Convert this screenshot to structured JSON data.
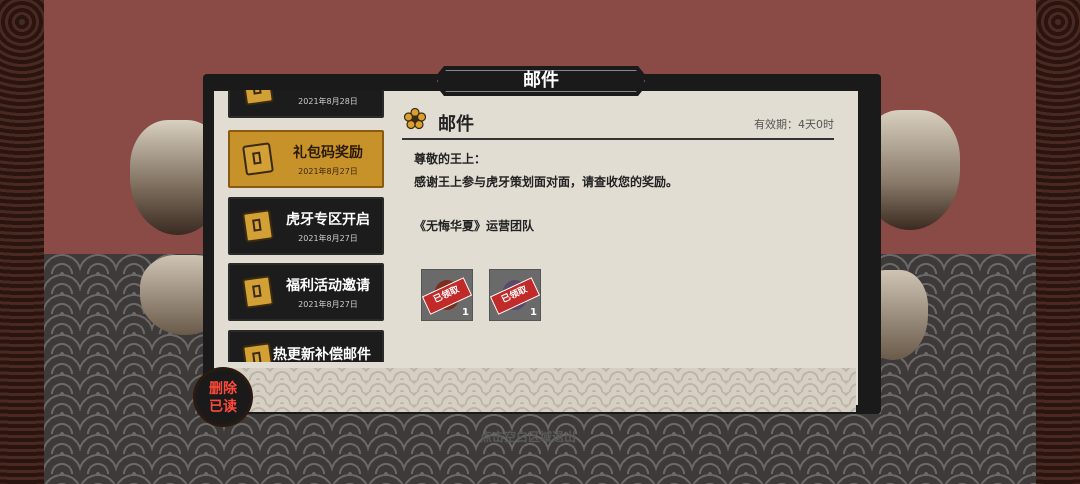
{
  "window": {
    "title": "邮件"
  },
  "mail_list": [
    {
      "title": "",
      "date": "2021年8月28日",
      "active": false
    },
    {
      "title": "礼包码奖励",
      "date": "2021年8月27日",
      "active": true
    },
    {
      "title": "虎牙专区开启",
      "date": "2021年8月27日",
      "active": false
    },
    {
      "title": "福利活动邀请",
      "date": "2021年8月27日",
      "active": false
    },
    {
      "title": "热更新补偿邮件",
      "date": "",
      "active": false
    }
  ],
  "mail": {
    "header_title": "邮件",
    "validity": "有效期：4天0时",
    "greeting": "尊敬的王上：",
    "body": "感谢王上参与虎牙策划面对面，请查收您的奖励。",
    "signature": "《无悔华夏》运营团队",
    "rewards": [
      {
        "stamp": "已领取",
        "count": "1",
        "color": "#7a3020"
      },
      {
        "stamp": "已领取",
        "count": "1",
        "color": "#5a4a6a"
      }
    ]
  },
  "delete_button": {
    "line1": "删除",
    "line2": "已读"
  },
  "exit_hint": "点击空白区域退出"
}
